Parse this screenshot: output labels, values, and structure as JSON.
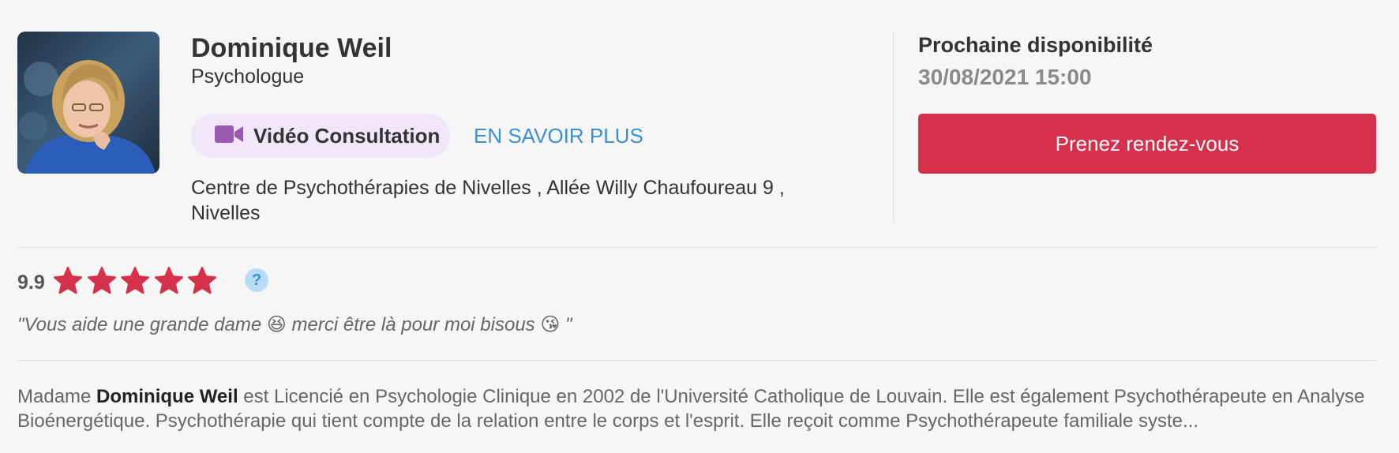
{
  "doctor": {
    "name": "Dominique Weil",
    "specialty": "Psychologue",
    "video_label": "Vidéo Consultation",
    "more_label": "EN SAVOIR PLUS",
    "address": "Centre de Psychothérapies de Nivelles , Allée Willy Chaufoureau 9 , Nivelles"
  },
  "availability": {
    "title": "Prochaine disponibilité",
    "datetime": "30/08/2021 15:00",
    "book_label": "Prenez rendez-vous"
  },
  "rating": {
    "score": "9.9",
    "stars": 5,
    "max_stars": 5,
    "help_label": "?",
    "review": "\"Vous aide une grande dame 😆 merci être là pour moi bisous 😘 \""
  },
  "bio": {
    "prefix": "Madame ",
    "name": "Dominique Weil",
    "text": " est Licencié en Psychologie Clinique en 2002 de l'Université Catholique de Louvain. Elle est également Psychothérapeute en Analyse Bioénergétique. Psychothérapie qui tient compte de la relation entre le corps et l'esprit. Elle reçoit comme Psychothérapeute familiale syste",
    "ellipsis": "..."
  },
  "colors": {
    "accent": "#d6314a",
    "link": "#3b8fd3",
    "video_bg": "#f1e6f9",
    "video_icon": "#9b59b6"
  },
  "icons": {
    "video": "video-camera-icon",
    "star": "star-icon",
    "help": "question-circle-icon"
  }
}
